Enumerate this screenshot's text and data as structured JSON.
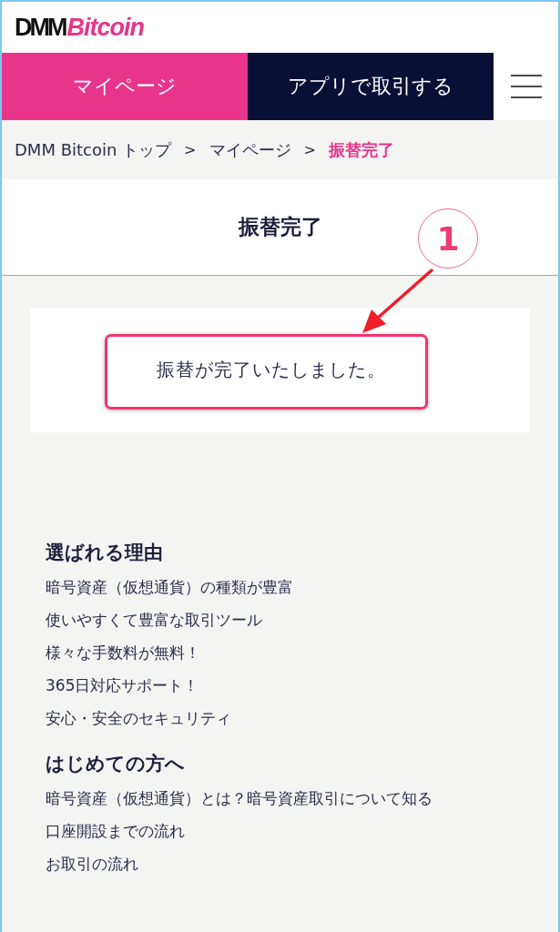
{
  "logo": {
    "part1": "DMM",
    "part2": "Bitcoin"
  },
  "nav": {
    "tabs": [
      {
        "label": "マイページ",
        "kind": "primary"
      },
      {
        "label": "アプリで取引する",
        "kind": "dark"
      }
    ]
  },
  "breadcrumb": {
    "separator": ">",
    "items": [
      {
        "label": "DMM Bitcoin トップ",
        "current": false
      },
      {
        "label": "マイページ",
        "current": false
      },
      {
        "label": "振替完了",
        "current": true
      }
    ]
  },
  "page_title": "振替完了",
  "message": "振替が完了いたしました。",
  "annotation": {
    "number": "1"
  },
  "sections": [
    {
      "heading": "選ばれる理由",
      "links": [
        "暗号資産（仮想通貨）の種類が豊富",
        "使いやすくて豊富な取引ツール",
        "様々な手数料が無料！",
        "365日対応サポート！",
        "安心・安全のセキュリティ"
      ]
    },
    {
      "heading": "はじめての方へ",
      "links": [
        "暗号資産（仮想通貨）とは？暗号資産取引について知る",
        "口座開設までの流れ",
        "お取引の流れ"
      ]
    }
  ]
}
